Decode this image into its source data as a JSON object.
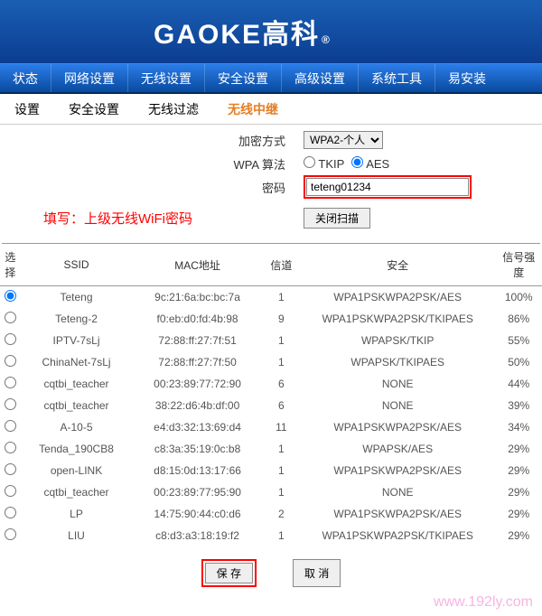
{
  "logo": {
    "en": "GAOKE",
    "cn": "高科",
    "reg": "®"
  },
  "mainnav": [
    "状态",
    "网络设置",
    "无线设置",
    "安全设置",
    "高级设置",
    "系统工具",
    "易安装"
  ],
  "subnav": [
    {
      "label": "设置",
      "active": false
    },
    {
      "label": "安全设置",
      "active": false
    },
    {
      "label": "无线过滤",
      "active": false
    },
    {
      "label": "无线中继",
      "active": true
    }
  ],
  "form": {
    "encrypt_label": "加密方式",
    "encrypt_value": "WPA2-个人",
    "algo_label": "WPA 算法",
    "algo_tkip": "TKIP",
    "algo_aes": "AES",
    "algo_selected": "AES",
    "pwd_label": "密码",
    "pwd_value": "teteng01234"
  },
  "hint": "填写：上级无线WiFi密码",
  "close_scan": "关闭扫描",
  "table": {
    "headers": {
      "sel": "选择",
      "ssid": "SSID",
      "mac": "MAC地址",
      "ch": "信道",
      "sec": "安全",
      "sig": "信号强度"
    },
    "rows": [
      {
        "sel": true,
        "ssid": "Teteng",
        "mac": "9c:21:6a:bc:bc:7a",
        "ch": "1",
        "sec": "WPA1PSKWPA2PSK/AES",
        "sig": "100%"
      },
      {
        "sel": false,
        "ssid": "Teteng-2",
        "mac": "f0:eb:d0:fd:4b:98",
        "ch": "9",
        "sec": "WPA1PSKWPA2PSK/TKIPAES",
        "sig": "86%"
      },
      {
        "sel": false,
        "ssid": "IPTV-7sLj",
        "mac": "72:88:ff:27:7f:51",
        "ch": "1",
        "sec": "WPAPSK/TKIP",
        "sig": "55%"
      },
      {
        "sel": false,
        "ssid": "ChinaNet-7sLj",
        "mac": "72:88:ff:27:7f:50",
        "ch": "1",
        "sec": "WPAPSK/TKIPAES",
        "sig": "50%"
      },
      {
        "sel": false,
        "ssid": "cqtbi_teacher",
        "mac": "00:23:89:77:72:90",
        "ch": "6",
        "sec": "NONE",
        "sig": "44%"
      },
      {
        "sel": false,
        "ssid": "cqtbi_teacher",
        "mac": "38:22:d6:4b:df:00",
        "ch": "6",
        "sec": "NONE",
        "sig": "39%"
      },
      {
        "sel": false,
        "ssid": "A-10-5",
        "mac": "e4:d3:32:13:69:d4",
        "ch": "11",
        "sec": "WPA1PSKWPA2PSK/AES",
        "sig": "34%"
      },
      {
        "sel": false,
        "ssid": "Tenda_190CB8",
        "mac": "c8:3a:35:19:0c:b8",
        "ch": "1",
        "sec": "WPAPSK/AES",
        "sig": "29%"
      },
      {
        "sel": false,
        "ssid": "open-LINK",
        "mac": "d8:15:0d:13:17:66",
        "ch": "1",
        "sec": "WPA1PSKWPA2PSK/AES",
        "sig": "29%"
      },
      {
        "sel": false,
        "ssid": "cqtbi_teacher",
        "mac": "00:23:89:77:95:90",
        "ch": "1",
        "sec": "NONE",
        "sig": "29%"
      },
      {
        "sel": false,
        "ssid": "LP",
        "mac": "14:75:90:44:c0:d6",
        "ch": "2",
        "sec": "WPA1PSKWPA2PSK/AES",
        "sig": "29%"
      },
      {
        "sel": false,
        "ssid": "LIU",
        "mac": "c8:d3:a3:18:19:f2",
        "ch": "1",
        "sec": "WPA1PSKWPA2PSK/TKIPAES",
        "sig": "29%"
      }
    ]
  },
  "buttons": {
    "save": "保 存",
    "cancel": "取 消"
  },
  "watermark": "www.192ly.com"
}
